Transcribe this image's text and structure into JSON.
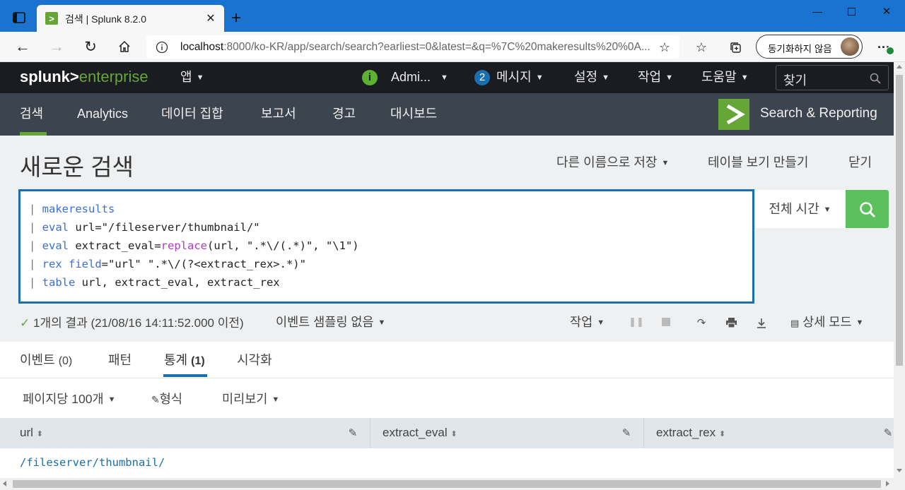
{
  "browser": {
    "tab_title": "검색 | Splunk 8.2.0",
    "url_host": "localhost",
    "url_rest": ":8000/ko-KR/app/search/search?earliest=0&latest=&q=%7C%20makeresults%20%0A...",
    "sync_label": "동기화하지 않음",
    "icons": [
      "sidebar-icon",
      "splunk-favicon",
      "close-icon",
      "new-tab-icon",
      "back-icon",
      "forward-icon",
      "refresh-icon",
      "home-icon",
      "info-icon",
      "add-favorite-icon",
      "favorites-icon",
      "collections-icon",
      "more-icon"
    ]
  },
  "topbar": {
    "logo_splunk": "splunk>",
    "logo_enterprise": "enterprise",
    "app_menu": "앱",
    "user_menu": "Admi...",
    "messages_count": "2",
    "messages_label": "메시지",
    "settings_label": "설정",
    "activity_label": "작업",
    "help_label": "도움말",
    "find_placeholder": "찾기"
  },
  "appbar": {
    "tabs": [
      "검색",
      "Analytics",
      "데이터 집합",
      "보고서",
      "경고",
      "대시보드"
    ],
    "active_tab": "검색",
    "app_name": "Search & Reporting",
    "accent_color": "#65a637"
  },
  "page": {
    "title": "새로운 검색",
    "save_as": "다른 이름으로 저장",
    "create_table": "테이블 보기 만들기",
    "close": "닫기"
  },
  "search": {
    "lines": [
      {
        "pipe": "| ",
        "cmd": "makeresults",
        "rest": ""
      },
      {
        "pipe": "| ",
        "cmd": "eval",
        "rest": " url=\"/fileserver/thumbnail/\""
      },
      {
        "pipe": "| ",
        "cmd": "eval",
        "rest_a": " extract_eval=",
        "fn": "replace",
        "rest_b": "(url, \".*\\/(.*)\", \"\\1\")"
      },
      {
        "pipe": "| ",
        "cmd": "rex",
        "arg": " field",
        "rest": "=\"url\" \".*\\/(?<extract_rex>.*)\""
      },
      {
        "pipe": "| ",
        "cmd": "table",
        "rest": " url, extract_eval, extract_rex"
      }
    ],
    "time_range": "전체 시간"
  },
  "status": {
    "result_text": "1개의 결과 (21/08/16 14:11:52.000 이전)",
    "sampling": "이벤트 샘플링 없음",
    "job_menu": "작업",
    "mode": "상세 모드"
  },
  "result_tabs": {
    "events": "이벤트",
    "events_count": "(0)",
    "patterns": "패턴",
    "statistics": "통계",
    "statistics_count": "(1)",
    "visualization": "시각화"
  },
  "options": {
    "per_page": "페이지당 100개",
    "format": "형식",
    "preview": "미리보기"
  },
  "table": {
    "columns": [
      "url",
      "extract_eval",
      "extract_rex"
    ],
    "rows": [
      [
        "/fileserver/thumbnail/",
        "",
        ""
      ]
    ]
  }
}
